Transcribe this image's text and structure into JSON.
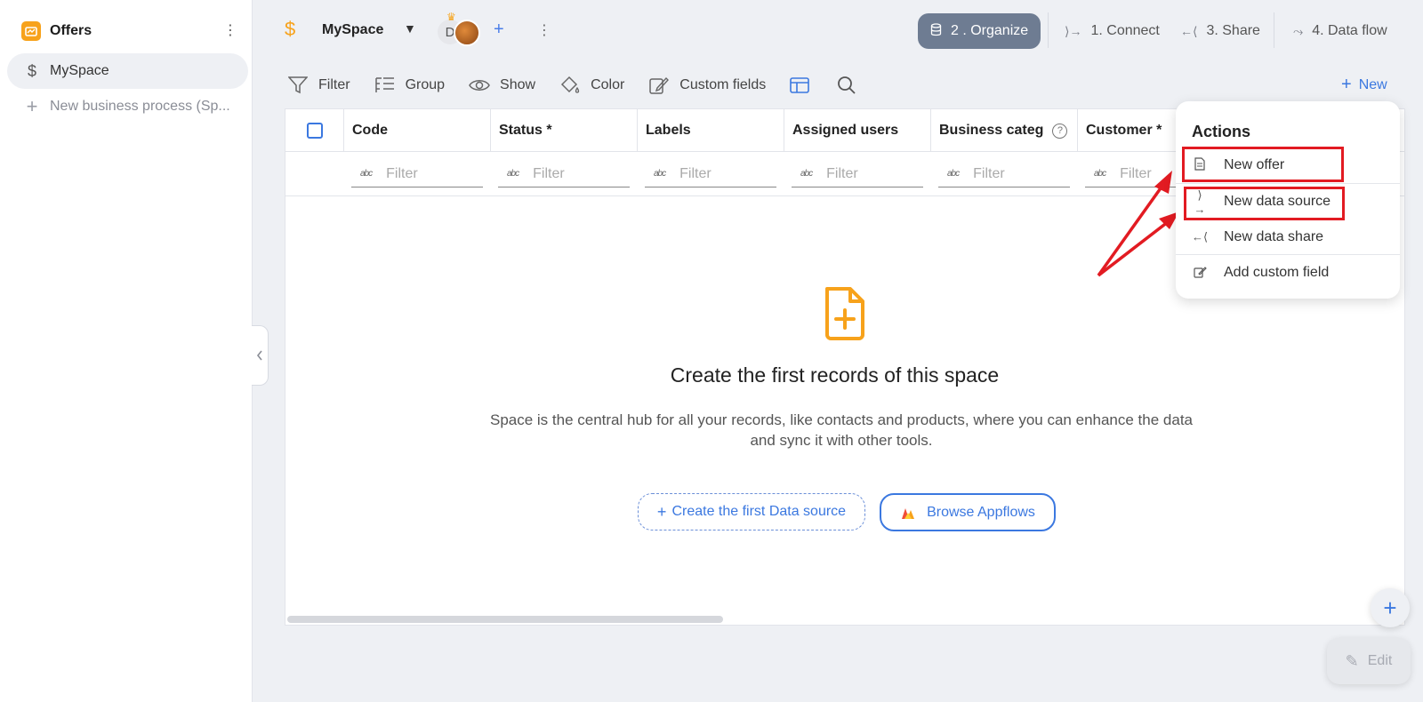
{
  "sidebar": {
    "title": "Offers",
    "items": [
      {
        "label": "MySpace",
        "icon": "dollar-icon"
      },
      {
        "label": "New business process (Sp...",
        "icon": "plus-icon"
      }
    ]
  },
  "topbar": {
    "space_name": "MySpace",
    "avatar_initial": "D",
    "steps": {
      "organize": "2 . Organize",
      "connect": "1. Connect",
      "share": "3. Share",
      "flow": "4. Data flow"
    }
  },
  "toolbar": {
    "filter": "Filter",
    "group": "Group",
    "show": "Show",
    "color": "Color",
    "custom_fields": "Custom fields",
    "new": "New"
  },
  "table": {
    "columns": [
      "Code",
      "Status *",
      "Labels",
      "Assigned users",
      "Business categ",
      "Customer *"
    ],
    "filter_placeholder": "Filter",
    "abc_label": "abc"
  },
  "empty_state": {
    "title": "Create the first records of this space",
    "text": "Space is the central hub for all your records, like contacts and products, where you can enhance the data and sync it with other tools.",
    "create_button": "Create the first Data source",
    "browse_button": "Browse Appflows"
  },
  "actions_menu": {
    "title": "Actions",
    "items": [
      "New offer",
      "New data source",
      "New data share",
      "Add custom field"
    ]
  },
  "edit_button": "Edit",
  "colors": {
    "accent": "#3b78e0",
    "brand_orange": "#f7a21b",
    "highlight_red": "#e21b22",
    "organize_bg": "#6e7c92"
  }
}
